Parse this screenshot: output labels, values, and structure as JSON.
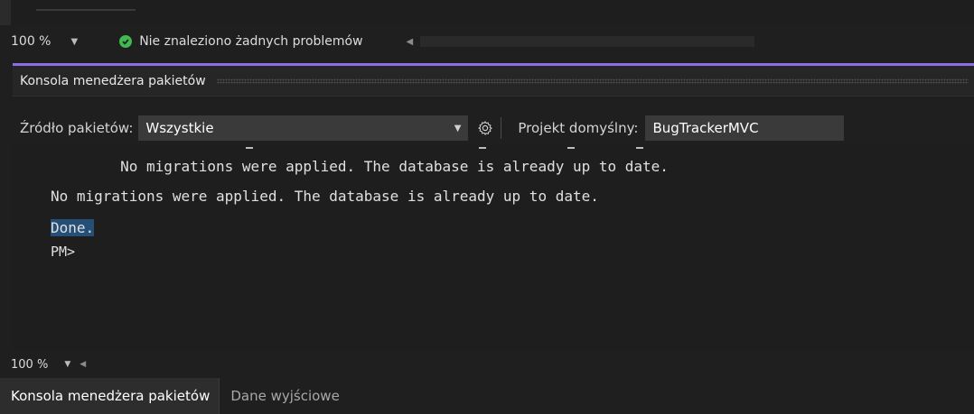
{
  "status_bar": {
    "zoom": "100 %",
    "message": "Nie znaleziono żadnych problemów"
  },
  "tool_window": {
    "title": "Konsola menedżera pakietów"
  },
  "toolbar": {
    "source_label": "Źródło pakietów:",
    "source_value": "Wszystkie",
    "project_label": "Projekt domyślny:",
    "project_value": "BugTrackerMVC"
  },
  "console": {
    "lines": [
      "        No migrations were applied. The database is already up to date.",
      "No migrations were applied. The database is already up to date.",
      "Done.",
      "PM>"
    ]
  },
  "bottom_zoom": {
    "zoom": "100 %"
  },
  "tabs": [
    {
      "label": "Konsola menedżera pakietów",
      "active": true
    },
    {
      "label": "Dane wyjściowe",
      "active": false
    }
  ],
  "icons": {
    "status_ok": "check-circle-icon",
    "settings": "gear-icon"
  },
  "colors": {
    "accent": "#8c6fe8",
    "ok": "#3fb950",
    "selection": "#264f78"
  }
}
